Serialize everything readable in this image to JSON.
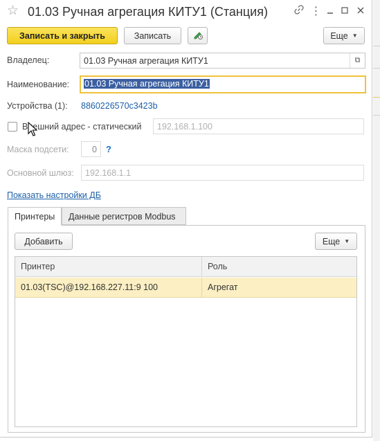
{
  "window": {
    "title": "01.03 Ручная агрегация КИТУ1 (Станция)",
    "icons": [
      "star-icon",
      "link-icon",
      "more-icon",
      "minimize-icon",
      "maximize-icon",
      "close-icon"
    ]
  },
  "toolbar": {
    "save_close_label": "Записать и закрыть",
    "save_label": "Записать",
    "more_label": "Еще"
  },
  "form": {
    "owner_label": "Владелец:",
    "owner_value": "01.03 Ручная агрегация КИТУ1",
    "name_label": "Наименование:",
    "name_value": "01.03 Ручная агрегация КИТУ1",
    "devices_label": "Устройства (1):",
    "devices_link": "8860226570c3423b",
    "static_label": "Внешний адрес - статический",
    "static_value": "192.168.1.100",
    "mask_label": "Маска подсети:",
    "mask_value": "0",
    "mask_help": "?",
    "gateway_label": "Основной шлюз:",
    "gateway_value": "192.168.1.1",
    "db_settings_link": "Показать настройки ДБ"
  },
  "tabs": [
    {
      "label": "Принтеры",
      "active": true
    },
    {
      "label": "Данные регистров Modbus",
      "active": false
    }
  ],
  "printers": {
    "add_label": "Добавить",
    "more_label": "Еще",
    "columns": [
      "Принтер",
      "Роль"
    ],
    "rows": [
      {
        "printer": "01.03(TSC)@192.168.227.11:9 100",
        "role": "Агрегат",
        "selected": true
      }
    ]
  },
  "colors": {
    "primary_button": "#f5d530",
    "selection_row": "#fbefc3",
    "link": "#1b5fa8",
    "focus_border": "#f0c23a",
    "text_selection": "#3b5fa0"
  }
}
